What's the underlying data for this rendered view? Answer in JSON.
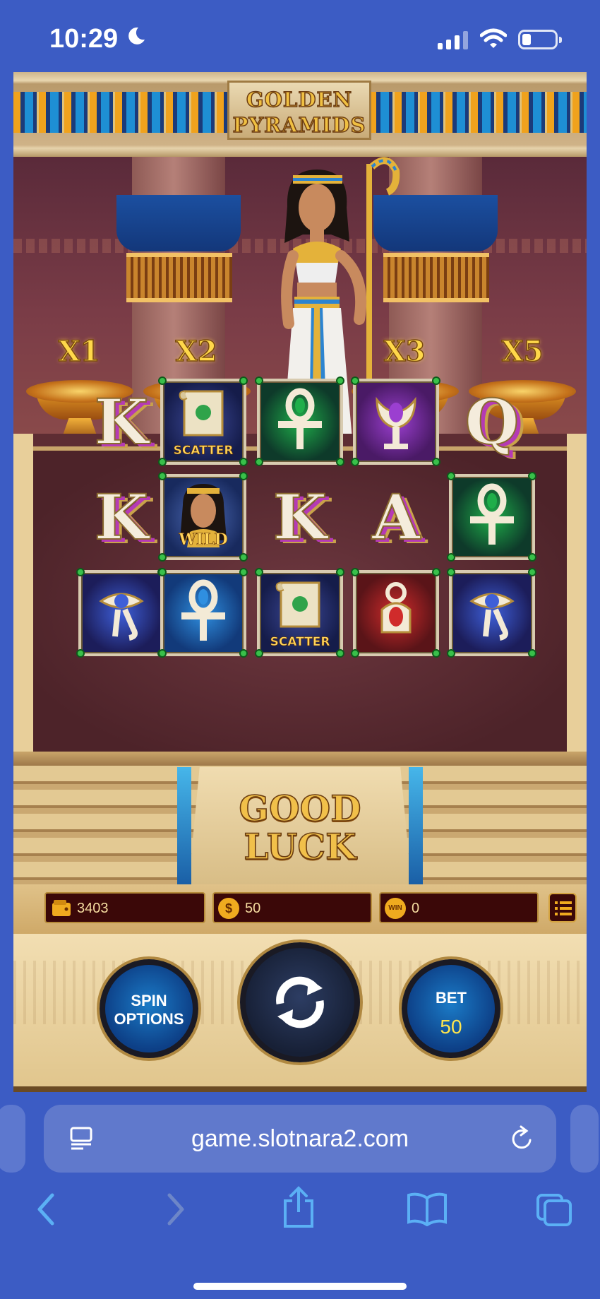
{
  "status_bar": {
    "time": "10:29",
    "icons": [
      "moon-icon",
      "cellular-signal-icon",
      "wifi-icon",
      "battery-icon"
    ]
  },
  "game": {
    "title_line1": "GOLDEN",
    "title_line2": "PYRAMIDS",
    "multipliers": [
      "X1",
      "X2",
      "X3",
      "X5"
    ],
    "reels": [
      [
        {
          "type": "letter",
          "symbol": "K"
        },
        {
          "type": "scatter",
          "label": "SCATTER"
        },
        {
          "type": "icon",
          "symbol": "green-ankh"
        },
        {
          "type": "icon",
          "symbol": "purple-lotus"
        },
        {
          "type": "letter",
          "symbol": "Q"
        }
      ],
      [
        {
          "type": "letter",
          "symbol": "K"
        },
        {
          "type": "wild",
          "label": "WILD"
        },
        {
          "type": "letter",
          "symbol": "K"
        },
        {
          "type": "letter",
          "symbol": "A"
        },
        {
          "type": "icon",
          "symbol": "green-ankh"
        }
      ],
      [
        {
          "type": "icon",
          "symbol": "eye-of-horus"
        },
        {
          "type": "icon",
          "symbol": "blue-ankh"
        },
        {
          "type": "scatter",
          "label": "SCATTER"
        },
        {
          "type": "icon",
          "symbol": "red-amulet"
        },
        {
          "type": "icon",
          "symbol": "eye-of-horus"
        }
      ]
    ],
    "message_line1": "GOOD",
    "message_line2": "LUCK",
    "info": {
      "balance": "3403",
      "bet": "50",
      "win_icon": "WIN",
      "win": "0",
      "coin_icon": "$"
    },
    "controls": {
      "spin_options_line1": "SPIN",
      "spin_options_line2": "OPTIONS",
      "bet_label": "BET",
      "bet_value": "50"
    }
  },
  "browser": {
    "url": "game.slotnara2.com"
  },
  "colors": {
    "accent_gold": "#f1c04a",
    "button_blue": "#1b7bc7",
    "browser_bg": "#3c5cc4"
  }
}
